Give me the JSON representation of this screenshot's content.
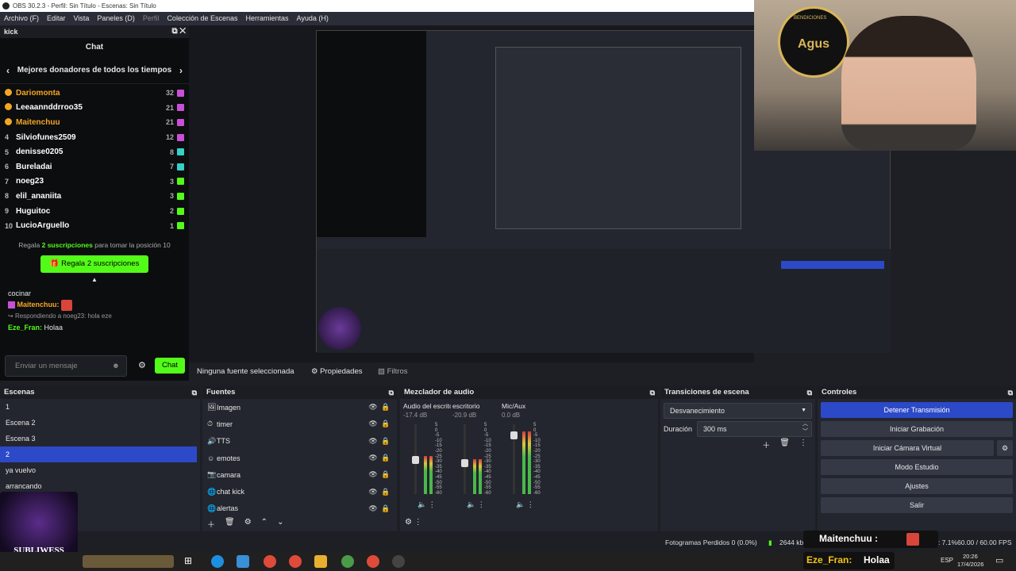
{
  "window": {
    "title": "OBS 30.2.3 - Perfil: Sin Título - Escenas: Sin Título"
  },
  "menu": [
    "Archivo (F)",
    "Editar",
    "Vista",
    "Paneles (D)",
    "Perfil",
    "Colección de Escenas",
    "Herramientas",
    "Ayuda (H)"
  ],
  "kick": {
    "dock_title": "kick",
    "chat_title": "Chat",
    "leaderboard_title": "Mejores donadores de todos los tiempos",
    "donors": [
      {
        "rank": "",
        "name": "Dariomonta",
        "count": "32",
        "color": "#f5a623",
        "gift": "#c84fd8"
      },
      {
        "rank": "",
        "name": "Leeaannddrroo35",
        "count": "21",
        "color": "#ffffff",
        "gift": "#c84fd8"
      },
      {
        "rank": "",
        "name": "Maitenchuu",
        "count": "21",
        "color": "#f5a623",
        "gift": "#c84fd8"
      },
      {
        "rank": "4",
        "name": "Silviofunes2509",
        "count": "12",
        "color": "#ffffff",
        "gift": "#c84fd8"
      },
      {
        "rank": "5",
        "name": "denisse0205",
        "count": "8",
        "color": "#ffffff",
        "gift": "#35d0c8"
      },
      {
        "rank": "6",
        "name": "Bureladai",
        "count": "7",
        "color": "#ffffff",
        "gift": "#35d0c8"
      },
      {
        "rank": "7",
        "name": "noeg23",
        "count": "3",
        "color": "#ffffff",
        "gift": "#53fc18"
      },
      {
        "rank": "8",
        "name": "elil_ananiita",
        "count": "3",
        "color": "#ffffff",
        "gift": "#53fc18"
      },
      {
        "rank": "9",
        "name": "Huguitoc",
        "count": "2",
        "color": "#ffffff",
        "gift": "#53fc18"
      },
      {
        "rank": "10",
        "name": "LucioArguello",
        "count": "1",
        "color": "#ffffff",
        "gift": "#53fc18"
      }
    ],
    "gift_note_prefix": "Regala",
    "gift_note_highlight": "2 suscripciones",
    "gift_note_suffix": "para tomar la posición 10",
    "gift_button": "Regala 2 suscripciones",
    "messages": [
      {
        "user": "",
        "text": "cocinar"
      },
      {
        "user": "Maitenchuu:",
        "text": ""
      }
    ],
    "reply_to": "Respondiendo a noeg23: hola eze",
    "last_user": "Eze_Fran:",
    "last_text": "Holaa",
    "input_placeholder": "Enviar un mensaje",
    "send_label": "Chat"
  },
  "sources_bar": {
    "no_selection": "Ninguna fuente seleccionada",
    "properties": "Propiedades",
    "filters": "Filtros"
  },
  "scenes": {
    "title": "Escenas",
    "items": [
      "1",
      "Escena 2",
      "Escena 3",
      "2",
      "ya vuelvo",
      "arrancando"
    ],
    "selected": "2"
  },
  "sources": {
    "title": "Fuentes",
    "items": [
      {
        "icon": "🖼",
        "name": "Imagen"
      },
      {
        "icon": "⏱",
        "name": "timer"
      },
      {
        "icon": "🔊",
        "name": "TTS"
      },
      {
        "icon": "☺",
        "name": "emotes"
      },
      {
        "icon": "📷",
        "name": "camara"
      },
      {
        "icon": "🌐",
        "name": "chat kick"
      },
      {
        "icon": "🌐",
        "name": "alertas"
      }
    ]
  },
  "mixer": {
    "title": "Mezclador de audio",
    "channels": [
      {
        "name": "Audio del escrito",
        "db": "-17.4 dB",
        "level": 0.55
      },
      {
        "name": "escritorio",
        "db": "-20.9 dB",
        "level": 0.5
      },
      {
        "name": "Mic/Aux",
        "db": "0.0 dB",
        "level": 0.9
      }
    ],
    "scale": [
      "5",
      "0",
      "-5",
      "-10",
      "-15",
      "-20",
      "-25",
      "-30",
      "-35",
      "-40",
      "-45",
      "-50",
      "-55",
      "-60"
    ]
  },
  "transitions": {
    "title": "Transiciones de escena",
    "selected": "Desvanecimiento",
    "duration_label": "Duración",
    "duration": "300 ms"
  },
  "controls": {
    "title": "Controles",
    "buttons": [
      "Detener Transmisión",
      "Iniciar Grabación",
      "Iniciar Cámara Virtual",
      "Modo Estudio",
      "Ajustes",
      "Salir"
    ]
  },
  "status": {
    "dropped": "Fotogramas Perdidos 0 (0.0%)",
    "bitrate": "2644 kb/s",
    "cpu": "CPU: 7.1%",
    "fps": "60.00 / 60.00 FPS"
  },
  "overlay": {
    "user1": "Maitenchuu :",
    "user2": "Eze_Fran:",
    "text2": "Holaa",
    "logo_text": "SUBLIWESS",
    "cam_sign": "BENDICIONES",
    "cam_name": "Agus"
  },
  "taskbar": {
    "lang": "ESP",
    "time": "20:26",
    "date": "17/4/2026"
  },
  "colors": {
    "kick_green": "#53fc18",
    "obs_blue": "#2c49c8",
    "gold": "#f5a623"
  }
}
